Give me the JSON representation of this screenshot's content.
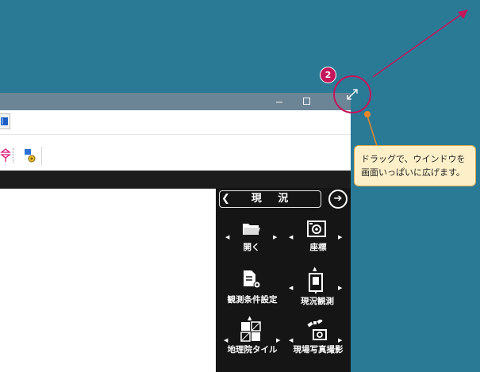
{
  "window": {
    "minimize_icon": "minimize-icon",
    "maximize_icon": "maximize-icon",
    "resize_icon": "diagonal-resize-icon"
  },
  "toolbar": {
    "icons": [
      "book-icon",
      "shape-tool-icon",
      "settings-tool-icon"
    ]
  },
  "panel": {
    "title": "現 況",
    "back_icon": "chevron-left-icon",
    "next_icon": "arrow-right-circle-icon",
    "buttons": [
      {
        "label": "開く",
        "icon": "folder-icon"
      },
      {
        "label": "座標",
        "icon": "camera-icon"
      },
      {
        "label": "観測条件設定",
        "icon": "document-settings-icon"
      },
      {
        "label": "現況観測",
        "icon": "total-station-icon"
      },
      {
        "label": "地理院タイル",
        "icon": "map-tile-icon"
      },
      {
        "label": "現場写真撮影",
        "icon": "satellite-camera-icon"
      }
    ]
  },
  "annotation": {
    "step_number": "2",
    "callout_text": "ドラッグで、ウインドウを画面いっぱいに広げます。"
  },
  "colors": {
    "desktop": "#2a7a96",
    "titlebar": "#6b8597",
    "panel": "#151515",
    "accent": "#c4165a",
    "callout_bg": "#fdf0c9",
    "callout_border": "#e2a94d"
  }
}
